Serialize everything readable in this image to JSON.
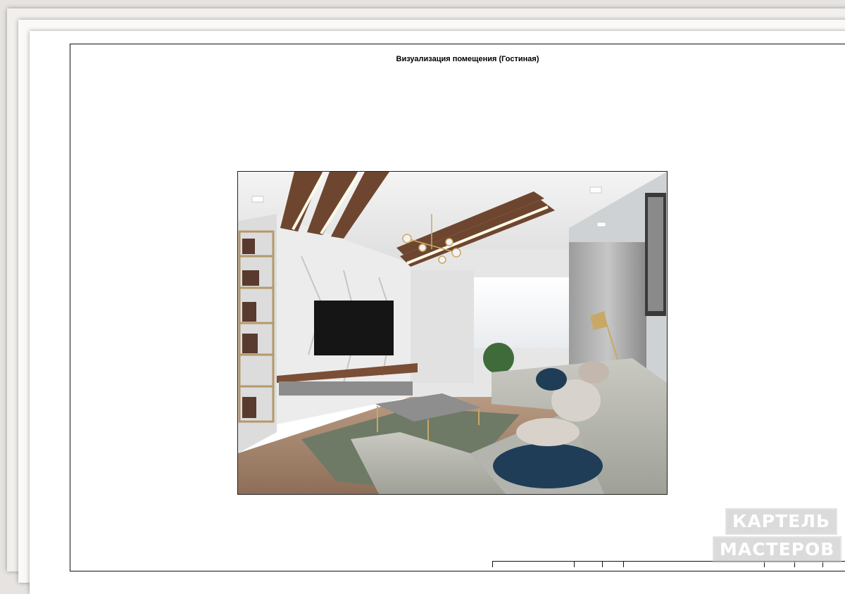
{
  "document": {
    "title": "Визуализация помещения (Гостиная)"
  },
  "watermark": {
    "line1": "КАРТЕЛЬ",
    "line2": "МАСТЕРОВ"
  }
}
